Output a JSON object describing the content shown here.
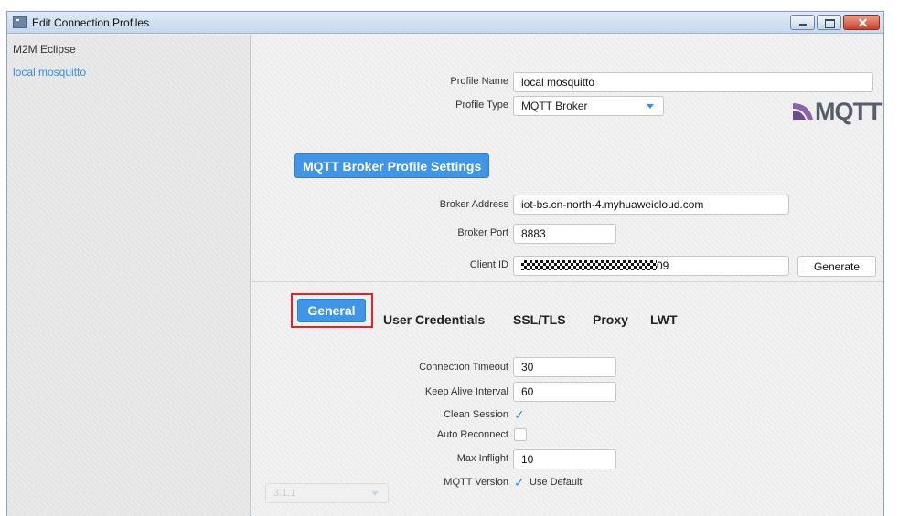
{
  "window": {
    "title": "Edit Connection Profiles"
  },
  "sidebar": {
    "items": [
      {
        "label": "M2M Eclipse"
      },
      {
        "label": "local mosquitto"
      }
    ]
  },
  "profile": {
    "name_label": "Profile Name",
    "name_value": "local mosquitto",
    "type_label": "Profile Type",
    "type_value": "MQTT Broker",
    "logo_text": "MQTT"
  },
  "broker": {
    "section_label": "MQTT Broker Profile Settings",
    "address_label": "Broker Address",
    "address_value": "iot-bs.cn-north-4.myhuaweicloud.com",
    "port_label": "Broker Port",
    "port_value": "8883",
    "client_id_label": "Client ID",
    "client_id_suffix": "09",
    "generate_label": "Generate"
  },
  "tabs": [
    {
      "label": "General"
    },
    {
      "label": "User Credentials"
    },
    {
      "label": "SSL/TLS"
    },
    {
      "label": "Proxy"
    },
    {
      "label": "LWT"
    }
  ],
  "general": {
    "timeout_label": "Connection Timeout",
    "timeout_value": "30",
    "keepalive_label": "Keep Alive Interval",
    "keepalive_value": "60",
    "clean_session_label": "Clean Session",
    "clean_session_checked": true,
    "auto_reconnect_label": "Auto Reconnect",
    "auto_reconnect_checked": false,
    "max_inflight_label": "Max Inflight",
    "max_inflight_value": "10",
    "mqtt_version_label": "MQTT Version",
    "use_default_label": "Use Default",
    "use_default_checked": true,
    "version_value": "3.1.1",
    "check_glyph": "✓"
  },
  "colors": {
    "accent": "#3f95e6",
    "highlight_border": "#e0242a",
    "selected_text": "#3a8fde"
  }
}
